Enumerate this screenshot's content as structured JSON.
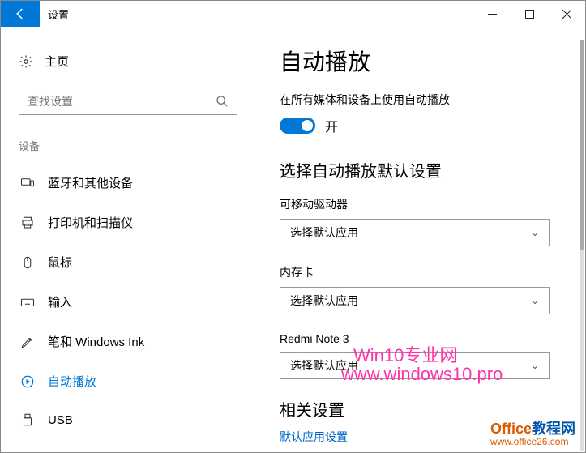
{
  "titlebar": {
    "title": "设置"
  },
  "sidebar": {
    "home": "主页",
    "search_placeholder": "查找设置",
    "category": "设备",
    "items": [
      {
        "label": "蓝牙和其他设备"
      },
      {
        "label": "打印机和扫描仪"
      },
      {
        "label": "鼠标"
      },
      {
        "label": "输入"
      },
      {
        "label": "笔和 Windows Ink"
      },
      {
        "label": "自动播放"
      },
      {
        "label": "USB"
      }
    ]
  },
  "main": {
    "heading": "自动播放",
    "toggle_desc": "在所有媒体和设备上使用自动播放",
    "toggle_state": "开",
    "defaults_heading": "选择自动播放默认设置",
    "fields": [
      {
        "label": "可移动驱动器",
        "value": "选择默认应用"
      },
      {
        "label": "内存卡",
        "value": "选择默认应用"
      },
      {
        "label": "Redmi Note 3",
        "value": "选择默认应用"
      }
    ],
    "related_heading": "相关设置",
    "related_link": "默认应用设置"
  },
  "watermark": {
    "line1": "Win10专业网",
    "line2": "www.windows10.pro",
    "brand1": "Office",
    "brand2": "教程网",
    "url": "www.office26.com"
  }
}
